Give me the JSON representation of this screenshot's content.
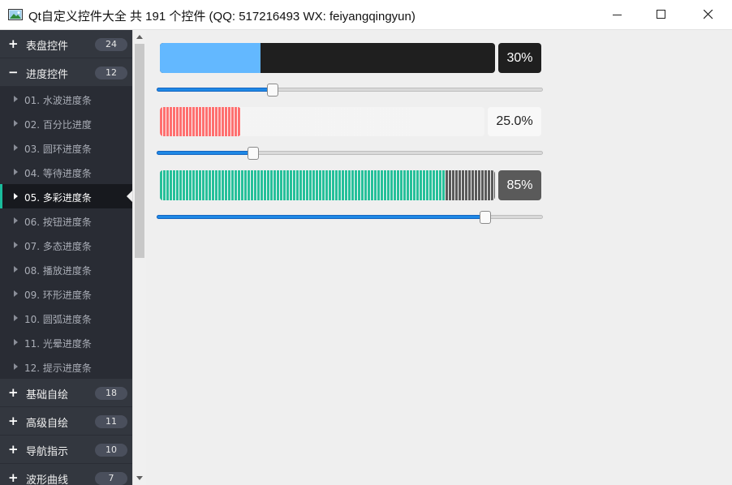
{
  "window": {
    "title": "Qt自定义控件大全 共 191 个控件 (QQ: 517216493 WX: feiyangqingyun)",
    "icon": "app-image-icon",
    "controls": [
      "minimize-icon",
      "maximize-icon",
      "close-icon"
    ]
  },
  "sidebar": {
    "groups_top": [
      {
        "icon": "+",
        "label": "表盘控件",
        "count": "24"
      },
      {
        "icon": "−",
        "label": "进度控件",
        "count": "12"
      }
    ],
    "items": [
      {
        "label": "01. 水波进度条"
      },
      {
        "label": "02. 百分比进度"
      },
      {
        "label": "03. 圆环进度条"
      },
      {
        "label": "04. 等待进度条"
      },
      {
        "label": "05. 多彩进度条"
      },
      {
        "label": "06. 按钮进度条"
      },
      {
        "label": "07. 多态进度条"
      },
      {
        "label": "08. 播放进度条"
      },
      {
        "label": "09. 环形进度条"
      },
      {
        "label": "10. 圆弧进度条"
      },
      {
        "label": "11. 光晕进度条"
      },
      {
        "label": "12. 提示进度条"
      }
    ],
    "active_index": 4,
    "groups_bottom": [
      {
        "icon": "+",
        "label": "基础自绘",
        "count": "18"
      },
      {
        "icon": "+",
        "label": "高级自绘",
        "count": "11"
      },
      {
        "icon": "+",
        "label": "导航指示",
        "count": "10"
      },
      {
        "icon": "+",
        "label": "波形曲线",
        "count": "7"
      }
    ]
  },
  "progress": [
    {
      "text": "30%",
      "value": 0.3,
      "slider": 0.3,
      "fill_color": "#63b8ff",
      "track_color": "#1f1f1f",
      "badge_bg": "#1f1f1f",
      "badge_fg": "#ffffff",
      "striped": false
    },
    {
      "text": "25.0%",
      "value": 0.25,
      "slider": 0.25,
      "fill_color": "#ff7070",
      "track_color": "#f4f4f4",
      "badge_bg": "#f8f8f8",
      "badge_fg": "#222222",
      "striped": true
    },
    {
      "text": "85%",
      "value": 0.85,
      "slider": 0.85,
      "fill_color": "#26c09a",
      "track_color": "#5a5a5a",
      "badge_bg": "#5a5a5a",
      "badge_fg": "#ffffff",
      "striped": true
    }
  ]
}
